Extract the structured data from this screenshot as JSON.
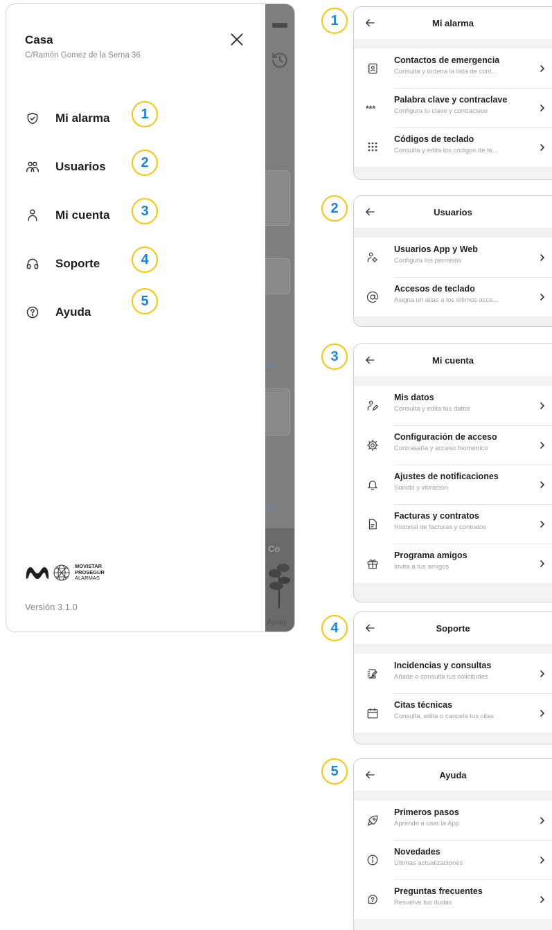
{
  "drawer": {
    "title": "Casa",
    "address": "C/Ramón Gomez de la Serna 36",
    "menu": [
      {
        "label": "Mi alarma",
        "icon": "shield-check-icon",
        "badge": "1"
      },
      {
        "label": "Usuarios",
        "icon": "users-icon",
        "badge": "2"
      },
      {
        "label": "Mi cuenta",
        "icon": "user-icon",
        "badge": "3"
      },
      {
        "label": "Soporte",
        "icon": "headset-icon",
        "badge": "4"
      },
      {
        "label": "Ayuda",
        "icon": "help-circle-icon",
        "badge": "5"
      }
    ],
    "logo": {
      "line1": "MOVISTAR",
      "line2": "PROSEGUR",
      "line3": "ALARMAS"
    },
    "version": "Versión 3.1.0"
  },
  "background": {
    "ghost1": "do",
    "ghost2": "do",
    "photo_text": "Co",
    "photo_caption": "Apag"
  },
  "panels": [
    {
      "badge": "1",
      "title": "Mi alarma",
      "rows": [
        {
          "title": "Contactos de emergencia",
          "subtitle": "Consulta y ordena la lista de cont...",
          "icon": "contacts-book-icon"
        },
        {
          "title": "Palabra clave y contraclave",
          "subtitle": "Configura tu clave y contraclave",
          "icon": "password-dots-icon"
        },
        {
          "title": "Códigos de teclado",
          "subtitle": "Consulta y edita los códigos de te...",
          "icon": "keypad-icon"
        }
      ]
    },
    {
      "badge": "2",
      "title": "Usuarios",
      "rows": [
        {
          "title": "Usuarios App y Web",
          "subtitle": "Configura los permisos",
          "icon": "user-settings-icon"
        },
        {
          "title": "Accesos de teclado",
          "subtitle": "Asigna un alias a los últimos acce...",
          "icon": "at-sign-icon"
        }
      ]
    },
    {
      "badge": "3",
      "title": "Mi cuenta",
      "rows": [
        {
          "title": "Mis datos",
          "subtitle": "Consulta y edita tus datos",
          "icon": "user-edit-icon"
        },
        {
          "title": "Configuración de acceso",
          "subtitle": "Contraseña y acceso biométrico",
          "icon": "gear-icon"
        },
        {
          "title": "Ajustes de notificaciones",
          "subtitle": "Sonido y vibración",
          "icon": "bell-icon"
        },
        {
          "title": "Facturas y contratos",
          "subtitle": "Historial de facturas y contratos",
          "icon": "document-icon"
        },
        {
          "title": "Programa amigos",
          "subtitle": "Invita a tus amigos",
          "icon": "gift-icon"
        }
      ]
    },
    {
      "badge": "4",
      "title": "Soporte",
      "rows": [
        {
          "title": "Incidencias y consultas",
          "subtitle": "Añade o consulta tus solicitudes",
          "icon": "ticket-edit-icon"
        },
        {
          "title": "Citas técnicas",
          "subtitle": "Consulta, edita o cancela tus citas",
          "icon": "calendar-icon"
        }
      ]
    },
    {
      "badge": "5",
      "title": "Ayuda",
      "rows": [
        {
          "title": "Primeros pasos",
          "subtitle": "Aprende a usar la App",
          "icon": "rocket-icon"
        },
        {
          "title": "Novedades",
          "subtitle": "Últimas actualizaciones",
          "icon": "info-circle-icon"
        },
        {
          "title": "Preguntas frecuentes",
          "subtitle": "Resuelve tus dudas",
          "icon": "chat-question-icon"
        }
      ]
    }
  ]
}
